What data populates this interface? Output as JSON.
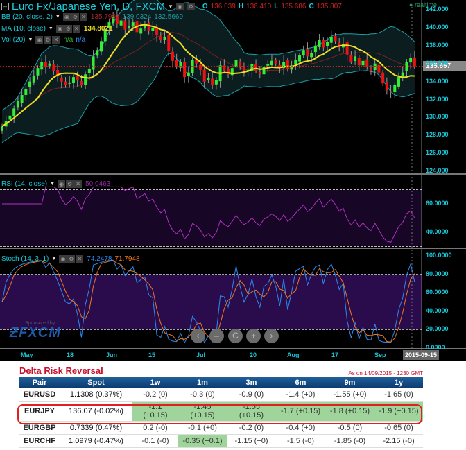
{
  "header": {
    "title": "Euro Fx/Japanese Yen, D, FXCM",
    "o_label": "O",
    "o": "136.039",
    "h_label": "H",
    "h": "136.410",
    "l_label": "L",
    "l": "135.686",
    "c_label": "C",
    "c": "135.807",
    "realtime": "realtime"
  },
  "indicators": {
    "bb": {
      "label": "BB (20, close, 2)",
      "v1": "135.7997",
      "v2": "139.0324",
      "v3": "132.5669"
    },
    "ma": {
      "label": "MA (10, close)",
      "v": "134.8021"
    },
    "vol": {
      "label": "Vol (20)",
      "v1": "n/a",
      "v2": "n/a"
    },
    "rsi": {
      "label": "RSI (14, close)",
      "v": "50.0463"
    },
    "stoch": {
      "label": "Stoch (14, 3, 1)",
      "v1": "74.2478",
      "v2": "71.7948"
    }
  },
  "sponsor": {
    "text": "Sponsored by",
    "brand": "FXCM"
  },
  "nav": [
    "‹",
    "–",
    "C",
    "+",
    "›"
  ],
  "colors": {
    "up": "#33ee33",
    "down": "#ee1111",
    "ma": "#f0e020",
    "bb": "#1aa0a8",
    "rsi": "#b030c0",
    "stochK": "#2a8cf0",
    "stochD": "#f07820",
    "axis": "#19c8d8"
  },
  "chart_data": {
    "type": "candlestick",
    "title": "Euro Fx/Japanese Yen, D, FXCM",
    "price_axis": {
      "ticks": [
        "142.000",
        "140.000",
        "138.000",
        "136.000",
        "134.000",
        "132.000",
        "130.000",
        "128.000",
        "126.000",
        "124.000"
      ],
      "range": [
        123.5,
        143
      ],
      "current": "135.697"
    },
    "rsi_axis": {
      "ticks": [
        "60.0000",
        "40.0000"
      ],
      "levels": [
        70,
        30
      ]
    },
    "stoch_axis": {
      "ticks": [
        "100.0000",
        "80.0000",
        "60.0000",
        "40.0000",
        "20.0000",
        "0.0000"
      ],
      "levels": [
        80,
        20
      ]
    },
    "x_labels": [
      "May",
      "18",
      "Jun",
      "15",
      "Jul",
      "20",
      "Aug",
      "17",
      "Sep"
    ],
    "current_date": "2015-09-15",
    "closes": [
      129.0,
      129.6,
      130.2,
      131.0,
      131.8,
      132.5,
      133.2,
      134.0,
      134.6,
      135.5,
      136.2,
      135.6,
      136.0,
      135.2,
      134.6,
      134.0,
      133.6,
      133.9,
      134.5,
      134.2,
      133.6,
      134.8,
      135.4,
      136.8,
      137.5,
      138.5,
      139.8,
      140.6,
      141.2,
      140.4,
      140.8,
      139.8,
      140.2,
      140.6,
      139.5,
      139.9,
      140.4,
      139.7,
      140.0,
      139.2,
      138.6,
      139.0,
      137.4,
      136.3,
      135.7,
      136.2,
      134.5,
      135.0,
      136.4,
      136.0,
      135.3,
      134.0,
      134.4,
      133.6,
      134.2,
      135.8,
      135.2,
      134.8,
      135.5,
      136.4,
      135.6,
      135.0,
      135.3,
      135.9,
      135.2,
      134.8,
      135.6,
      135.9,
      136.3,
      136.0,
      135.5,
      136.2,
      135.4,
      135.8,
      136.4,
      136.9,
      137.5,
      136.8,
      137.2,
      138.0,
      138.6,
      137.8,
      138.4,
      139.0,
      138.5,
      137.8,
      138.2,
      137.0,
      136.2,
      136.8,
      135.8,
      136.3,
      135.6,
      135.2,
      136.0,
      135.0,
      133.8,
      133.0,
      132.8,
      133.6,
      134.5,
      135.0,
      136.2,
      136.6,
      135.7
    ]
  },
  "table": {
    "title": "Delta Risk Reversal",
    "as_of": "As on 14/09/2015 - 1230 GMT",
    "headers": [
      "Pair",
      "Spot",
      "1w",
      "1m",
      "3m",
      "6m",
      "9m",
      "1y"
    ],
    "rows": [
      {
        "cells": [
          "EURUSD",
          "1.1308 (0.37%)",
          "-0.2 (0)",
          "-0.3 (0)",
          "-0.9 (0)",
          "-1.4 (+0)",
          "-1.55 (+0)",
          "-1.65 (0)"
        ]
      },
      {
        "cells": [
          "EURJPY",
          "136.07 (-0.02%)",
          "-1.1 (+0.15)",
          "-1.45 (+0.15)",
          "-1.55 (+0.15)",
          "-1.7 (+0.15)",
          "-1.8 (+0.15)",
          "-1.9 (+0.15)"
        ],
        "highlight": [
          2,
          3,
          4,
          5,
          6,
          7
        ]
      },
      {
        "cells": [
          "EURGBP",
          "0.7339 (0.47%)",
          "0.2 (-0)",
          "-0.1 (+0)",
          "-0.2 (0)",
          "-0.4 (+0)",
          "-0.5 (0)",
          "-0.65 (0)"
        ]
      },
      {
        "cells": [
          "EURCHF",
          "1.0979 (-0.47%)",
          "-0.1 (-0)",
          "-0.35 (+0.1)",
          "-1.15 (+0)",
          "-1.5 (-0)",
          "-1.85 (-0)",
          "-2.15 (-0)"
        ],
        "highlight": [
          3
        ]
      }
    ]
  }
}
